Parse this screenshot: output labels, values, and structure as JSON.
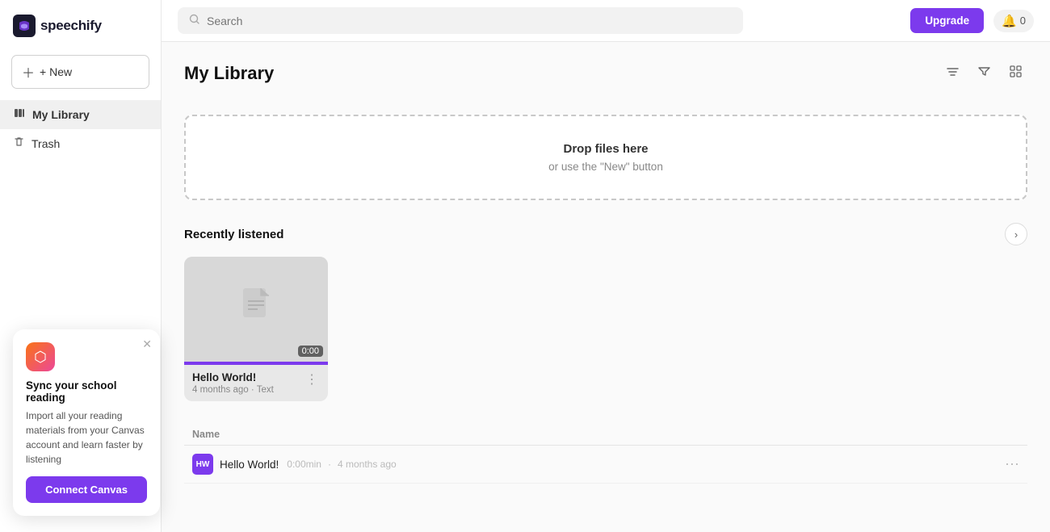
{
  "app": {
    "logo_text": "speechify",
    "logo_icon": "🎵"
  },
  "sidebar": {
    "new_button": "+ New",
    "items": [
      {
        "id": "my-library",
        "label": "My Library",
        "icon": "📚",
        "active": true
      },
      {
        "id": "trash",
        "label": "Trash",
        "icon": "🗑️",
        "active": false
      }
    ]
  },
  "topbar": {
    "search_placeholder": "Search",
    "upgrade_label": "Upgrade",
    "notifications_count": "0"
  },
  "main": {
    "page_title": "My Library",
    "toolbar_icons": [
      "sort",
      "filter",
      "layout"
    ],
    "drop_zone": {
      "title": "Drop files here",
      "subtitle": "or use the \"New\" button"
    },
    "recently_listened": {
      "section_title": "Recently listened",
      "cards": [
        {
          "name": "Hello World!",
          "meta": "4 months ago · Text",
          "time_badge": "0:00"
        }
      ]
    },
    "list": {
      "column_name": "Name",
      "rows": [
        {
          "icon_label": "HW",
          "name": "Hello World!",
          "duration": "0:00min",
          "date": "4 months ago"
        }
      ]
    }
  },
  "canvas_popup": {
    "title": "Sync your school reading",
    "body": "Import all your reading materials from your Canvas account and learn faster by listening",
    "connect_label": "Connect Canvas"
  }
}
